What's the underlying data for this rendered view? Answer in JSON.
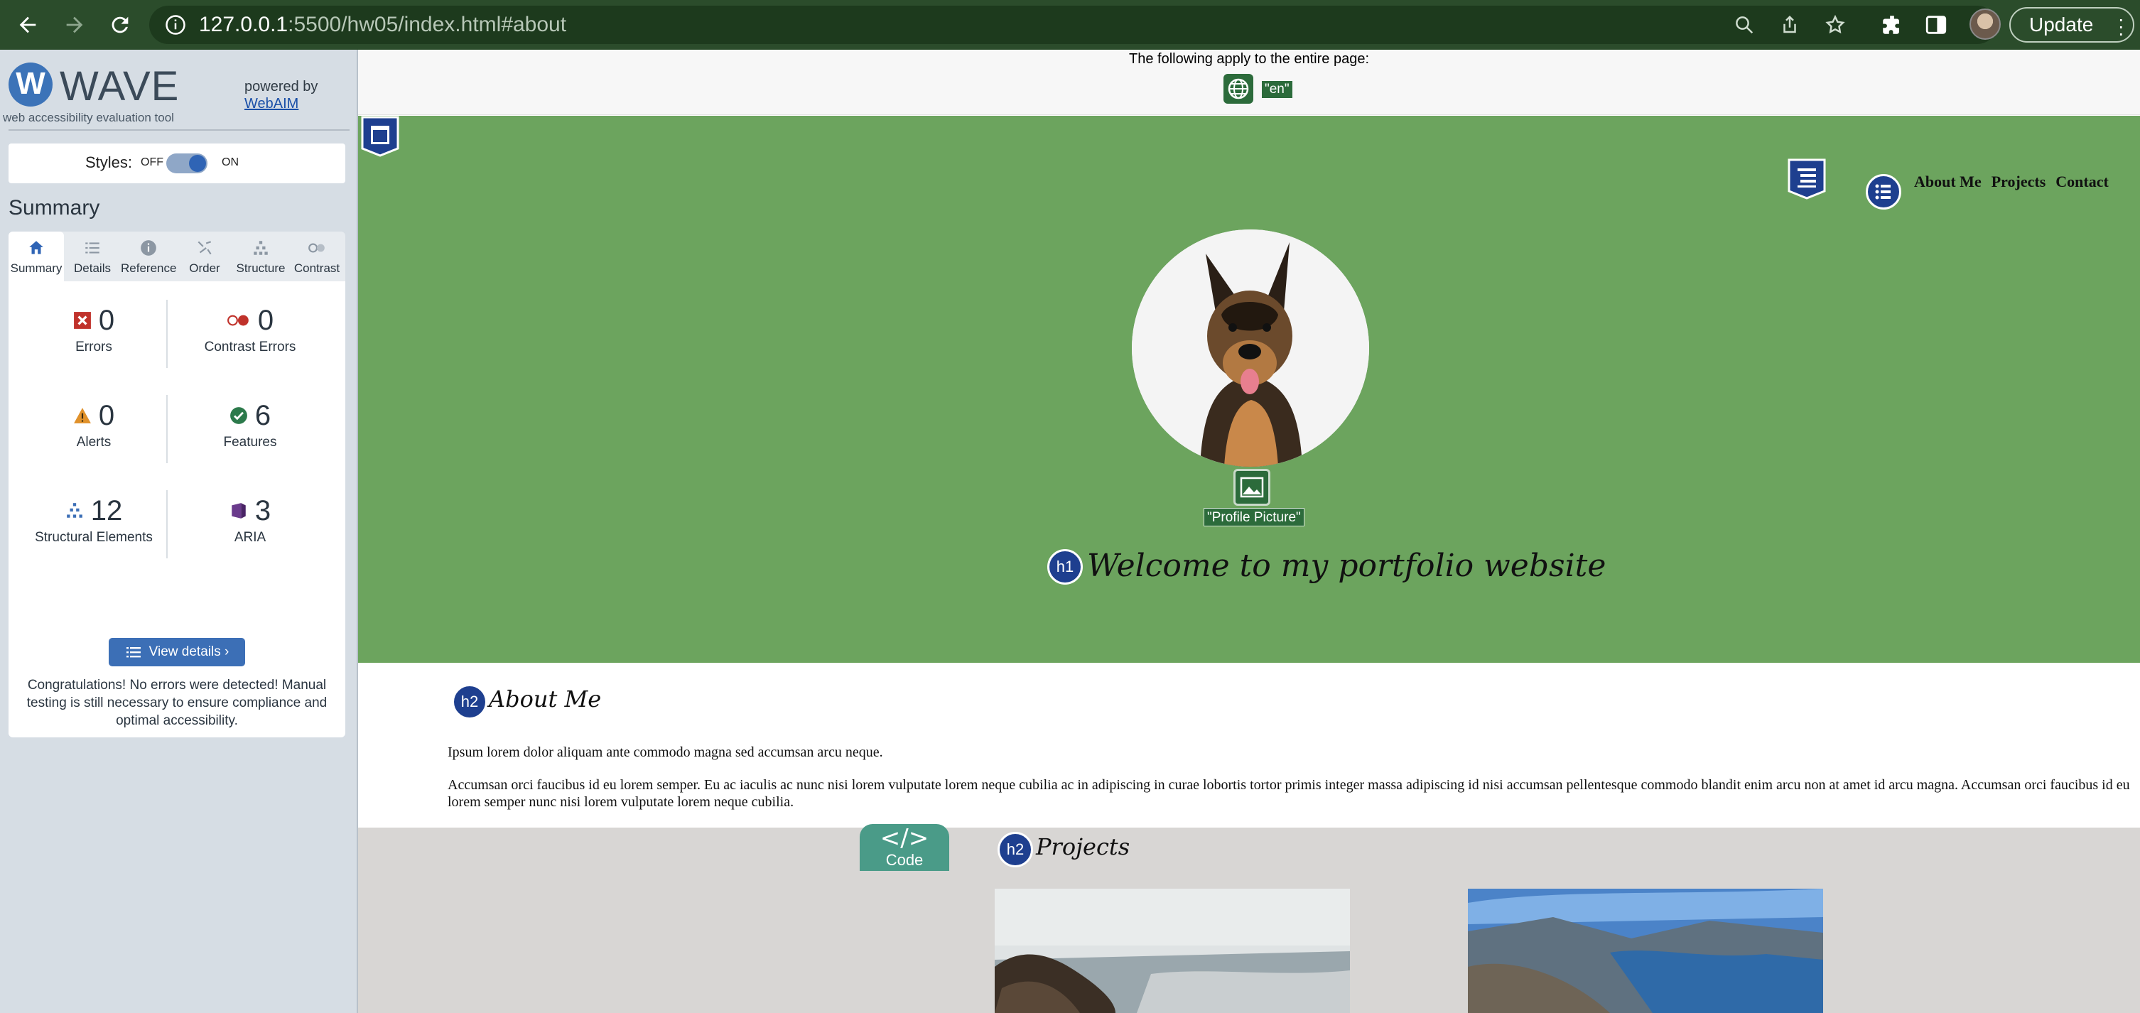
{
  "browser": {
    "url_host": "127.0.0.1",
    "url_rest": ":5500/hw05/index.html#about",
    "update_label": "Update"
  },
  "wave": {
    "logo_text": "WAVE",
    "tagline": "web accessibility evaluation tool",
    "powered_by": "powered by",
    "webaim_link": "WebAIM",
    "styles_label": "Styles:",
    "styles_off": "OFF",
    "styles_on": "ON",
    "summary_heading": "Summary",
    "tabs": [
      {
        "label": "Summary",
        "icon": "home-icon"
      },
      {
        "label": "Details",
        "icon": "list-icon"
      },
      {
        "label": "Reference",
        "icon": "info-icon"
      },
      {
        "label": "Order",
        "icon": "order-icon"
      },
      {
        "label": "Structure",
        "icon": "structure-icon"
      },
      {
        "label": "Contrast",
        "icon": "contrast-icon"
      }
    ],
    "stats": {
      "errors": {
        "value": "0",
        "label": "Errors"
      },
      "contrast_errors": {
        "value": "0",
        "label": "Contrast Errors"
      },
      "alerts": {
        "value": "0",
        "label": "Alerts"
      },
      "features": {
        "value": "6",
        "label": "Features"
      },
      "structural": {
        "value": "12",
        "label": "Structural Elements"
      },
      "aria": {
        "value": "3",
        "label": "ARIA"
      }
    },
    "view_details": "View details ›",
    "congrats": "Congratulations! No errors were detected! Manual testing is still necessary to ensure compliance and optimal accessibility."
  },
  "page": {
    "doc_note": "The following apply to the entire page:",
    "lang_tag": "\"en\"",
    "nav": [
      "About Me",
      "Projects",
      "Contact"
    ],
    "img_alt_tag": "\"Profile Picture\"",
    "h1_badge": "h1",
    "hero_title": "Welcome to my portfolio website",
    "h2_badge": "h2",
    "about_title": "About Me",
    "about_p1": "Ipsum lorem dolor aliquam ante commodo magna sed accumsan arcu neque.",
    "about_p2": "Accumsan orci faucibus id eu lorem semper. Eu ac iaculis ac nunc nisi lorem vulputate lorem neque cubilia ac in adipiscing in curae lobortis tortor primis integer massa adipiscing id nisi accumsan pellentesque commodo blandit enim arcu non at amet id arcu magna. Accumsan orci faucibus id eu lorem semper nunc nisi lorem vulputate lorem neque cubilia.",
    "projects_title": "Projects",
    "code_symbol": "</>",
    "code_label": "Code"
  },
  "colors": {
    "chrome": "#2b4c2b",
    "hero_green": "#6ca45e",
    "wave_blue": "#1e3f8f",
    "wave_green": "#2c6b3b",
    "projects_bg": "#d8d6d4"
  }
}
